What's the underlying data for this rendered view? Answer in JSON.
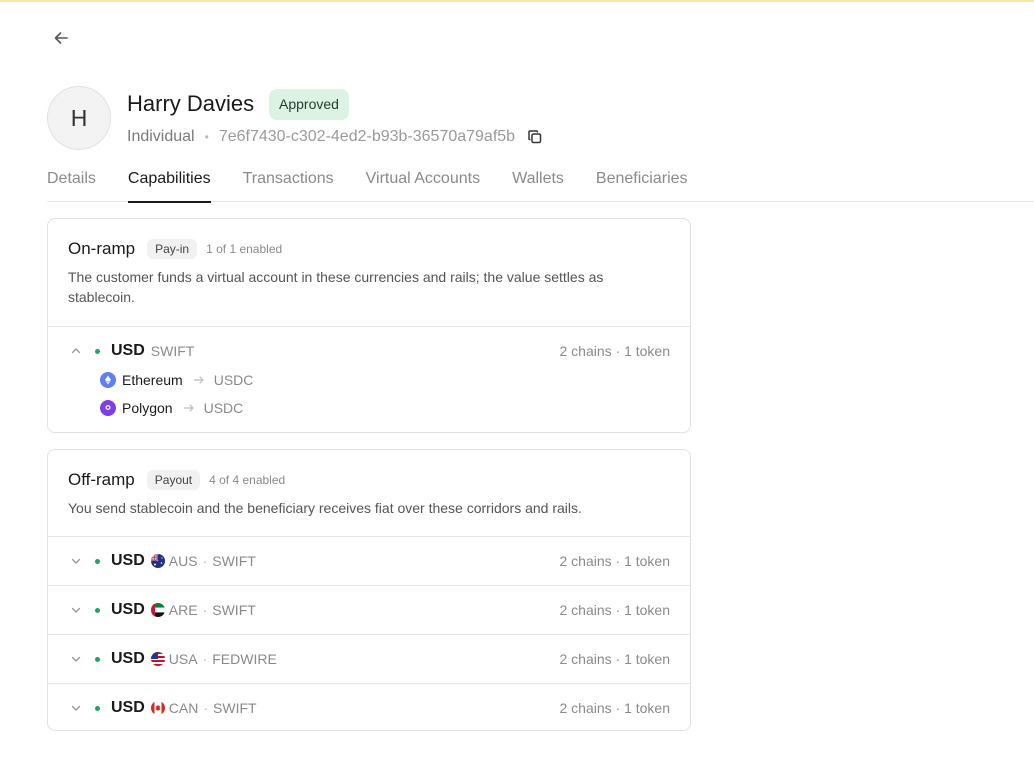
{
  "header": {
    "avatar_initial": "H",
    "name": "Harry Davies",
    "status": "Approved",
    "type": "Individual",
    "separator": "•",
    "customer_id": "7e6f7430-c302-4ed2-b93b-36570a79af5b"
  },
  "tabs": [
    {
      "label": "Details",
      "active": false
    },
    {
      "label": "Capabilities",
      "active": true
    },
    {
      "label": "Transactions",
      "active": false
    },
    {
      "label": "Virtual Accounts",
      "active": false
    },
    {
      "label": "Wallets",
      "active": false
    },
    {
      "label": "Beneficiaries",
      "active": false
    }
  ],
  "onramp": {
    "title": "On-ramp",
    "pill": "Pay-in",
    "enabled": "1 of 1 enabled",
    "description": "The customer funds a virtual account in these currencies and rails; the value settles as stablecoin.",
    "row": {
      "currency": "USD",
      "rail": "SWIFT",
      "meta": "2 chains · 1 token",
      "expanded": true,
      "chains": [
        {
          "name": "Ethereum",
          "token": "USDC",
          "icon": "ethereum-icon"
        },
        {
          "name": "Polygon",
          "token": "USDC",
          "icon": "polygon-icon"
        }
      ]
    }
  },
  "offramp": {
    "title": "Off-ramp",
    "pill": "Payout",
    "enabled": "4 of 4 enabled",
    "description": "You send stablecoin and the beneficiary receives fiat over these corridors and rails.",
    "separator": "·",
    "rows": [
      {
        "currency": "USD",
        "country": "AUS",
        "rail": "SWIFT",
        "meta": "2 chains · 1 token",
        "flag": "australia-flag-icon"
      },
      {
        "currency": "USD",
        "country": "ARE",
        "rail": "SWIFT",
        "meta": "2 chains · 1 token",
        "flag": "uae-flag-icon"
      },
      {
        "currency": "USD",
        "country": "USA",
        "rail": "FEDWIRE",
        "meta": "2 chains · 1 token",
        "flag": "usa-flag-icon"
      },
      {
        "currency": "USD",
        "country": "CAN",
        "rail": "SWIFT",
        "meta": "2 chains · 1 token",
        "flag": "canada-flag-icon"
      }
    ]
  },
  "colors": {
    "status_green": "#22a45a",
    "approved_bg": "#dcf3e4",
    "ethereum": "#627eea",
    "polygon": "#7b3fe4"
  }
}
